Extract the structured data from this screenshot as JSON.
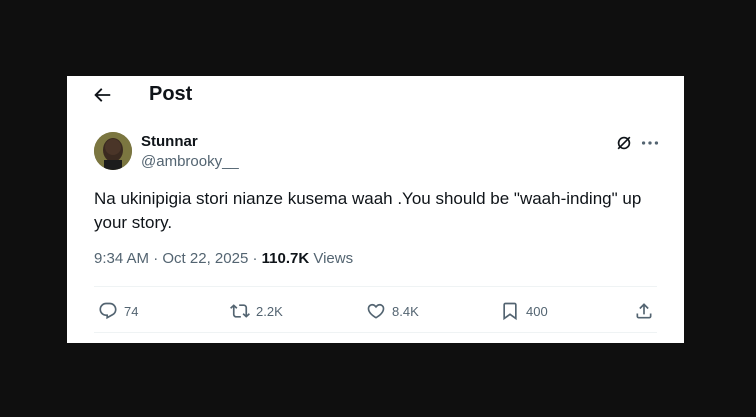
{
  "header": {
    "title": "Post"
  },
  "author": {
    "name": "Stunnar",
    "handle": "@ambrooky__"
  },
  "tweet": {
    "text": "Na ukinipigia stori nianze kusema waah .You should be \"waah-inding\" up your story."
  },
  "meta": {
    "time": "9:34 AM",
    "separator": "·",
    "date": "Oct 22, 2025",
    "views_count": "110.7K",
    "views_label": "Views"
  },
  "actions": {
    "replies": "74",
    "reposts": "2.2K",
    "likes": "8.4K",
    "bookmarks": "400"
  },
  "colors": {
    "text": "#0f1419",
    "secondary": "#536471",
    "divider": "#eff3f4",
    "backdrop": "#0f0f0f"
  },
  "icons": [
    "back-arrow-icon",
    "grok-icon",
    "more-icon",
    "reply-icon",
    "repost-icon",
    "like-icon",
    "bookmark-icon",
    "share-icon"
  ]
}
